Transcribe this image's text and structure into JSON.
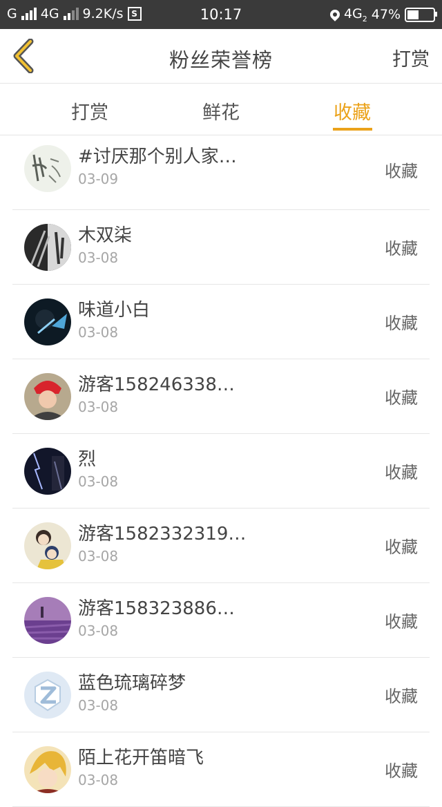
{
  "status_bar": {
    "carrier": "G",
    "network": "4G",
    "speed": "9.2K/s",
    "time": "10:17",
    "network_right": "4G",
    "network_right_sub": "2",
    "battery": "47%",
    "battery_level": 0.47
  },
  "header": {
    "title": "粉丝荣誉榜",
    "right_label": "打赏"
  },
  "tabs": [
    {
      "label": "打赏"
    },
    {
      "label": "鲜花"
    },
    {
      "label": "收藏"
    }
  ],
  "active_tab": 2,
  "rows": [
    {
      "name": "#讨厌那个别人家…",
      "date": "03-09",
      "action": "收藏"
    },
    {
      "name": "木双柒",
      "date": "03-08",
      "action": "收藏"
    },
    {
      "name": "味道小白",
      "date": "03-08",
      "action": "收藏"
    },
    {
      "name": "游客158246338…",
      "date": "03-08",
      "action": "收藏"
    },
    {
      "name": "烈",
      "date": "03-08",
      "action": "收藏"
    },
    {
      "name": "游客1582332319…",
      "date": "03-08",
      "action": "收藏"
    },
    {
      "name": "游客158323886…",
      "date": "03-08",
      "action": "收藏"
    },
    {
      "name": "蓝色琉璃碎梦",
      "date": "03-08",
      "action": "收藏"
    },
    {
      "name": "陌上花开笛暗飞",
      "date": "03-08",
      "action": "收藏"
    }
  ],
  "colors": {
    "accent": "#eba21a",
    "status_bar": "#3a3a3a",
    "text": "#444444",
    "subtext": "#a6a6a6"
  }
}
